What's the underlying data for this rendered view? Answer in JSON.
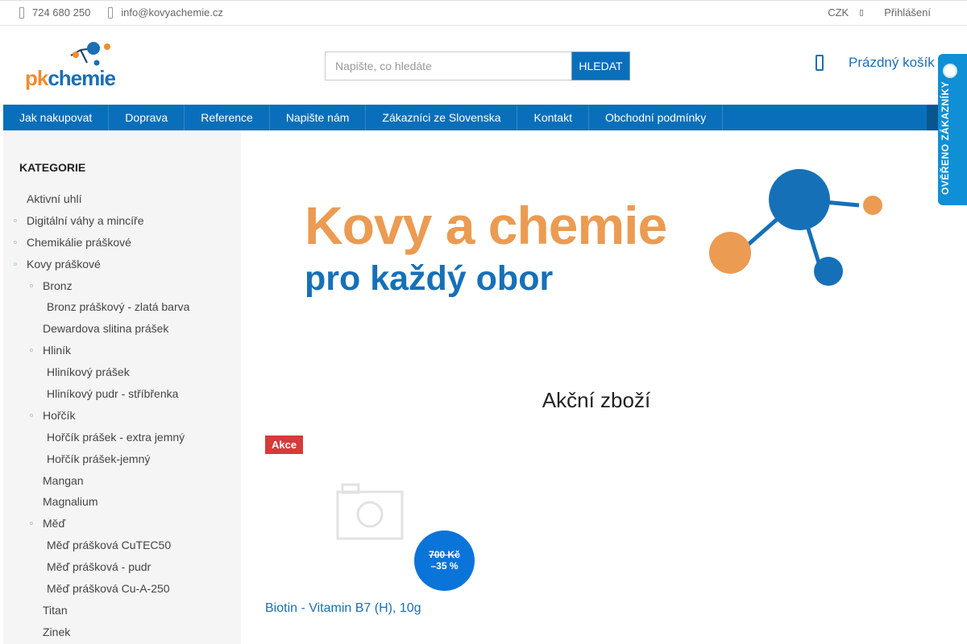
{
  "topbar": {
    "phone": "724 680 250",
    "email": "info@kovyachemie.cz",
    "currency": "CZK",
    "login": "Přihlášení"
  },
  "header": {
    "logo": {
      "pk": "pk",
      "chemie": "chemie"
    },
    "search": {
      "placeholder": "Napište, co hledáte",
      "button": "HLEDAT"
    },
    "cart": {
      "label": "Prázdný košík"
    }
  },
  "nav": {
    "items": [
      "Jak nakupovat",
      "Doprava",
      "Reference",
      "Napište nám",
      "Zákazníci ze Slovenska",
      "Kontakt",
      "Obchodní podmínky"
    ]
  },
  "badge": {
    "text": "OVĚŘENO ZÁKAZNÍKY"
  },
  "sidebar": {
    "title": "KATEGORIE",
    "categories": [
      {
        "label": "Aktivní uhlí",
        "level": 0,
        "dot": false
      },
      {
        "label": "Digitální váhy a mincíře",
        "level": 0,
        "dot": true
      },
      {
        "label": "Chemikálie práškové",
        "level": 0,
        "dot": true
      },
      {
        "label": "Kovy práškové",
        "level": 0,
        "dot": true
      },
      {
        "label": "Bronz",
        "level": 1,
        "dot": true
      },
      {
        "label": "Bronz práškový - zlatá barva",
        "level": 2,
        "dot": false
      },
      {
        "label": "Dewardova slitina prášek",
        "level": 1,
        "dot": false
      },
      {
        "label": "Hliník",
        "level": 1,
        "dot": true
      },
      {
        "label": "Hliníkový prášek",
        "level": 2,
        "dot": false
      },
      {
        "label": "Hliníkový pudr - stříbřenka",
        "level": 2,
        "dot": false
      },
      {
        "label": "Hořčík",
        "level": 1,
        "dot": true
      },
      {
        "label": "Hořčík prášek - extra jemný",
        "level": 2,
        "dot": false
      },
      {
        "label": "Hořčík prášek-jemný",
        "level": 2,
        "dot": false
      },
      {
        "label": "Mangan",
        "level": 1,
        "dot": false
      },
      {
        "label": "Magnalium",
        "level": 1,
        "dot": false
      },
      {
        "label": "Měď",
        "level": 1,
        "dot": true
      },
      {
        "label": "Měď prášková CuTEC50",
        "level": 2,
        "dot": false
      },
      {
        "label": "Měď prášková - pudr",
        "level": 2,
        "dot": false
      },
      {
        "label": "Měď prášková Cu-A-250",
        "level": 2,
        "dot": false
      },
      {
        "label": "Titan",
        "level": 1,
        "dot": false
      },
      {
        "label": "Zinek",
        "level": 1,
        "dot": false
      }
    ]
  },
  "banner": {
    "line1": "Kovy a chemie",
    "line2": "pro každý obor"
  },
  "main": {
    "section_title": "Akční zboží",
    "product": {
      "tag": "Akce",
      "old_price": "700 Kč",
      "discount": "–35 %",
      "name": "Biotin - Vitamin B7 (H), 10g"
    }
  },
  "colors": {
    "brand_blue": "#0a6fba",
    "brand_orange": "#f08c2f",
    "sale_red": "#d63a3a"
  }
}
